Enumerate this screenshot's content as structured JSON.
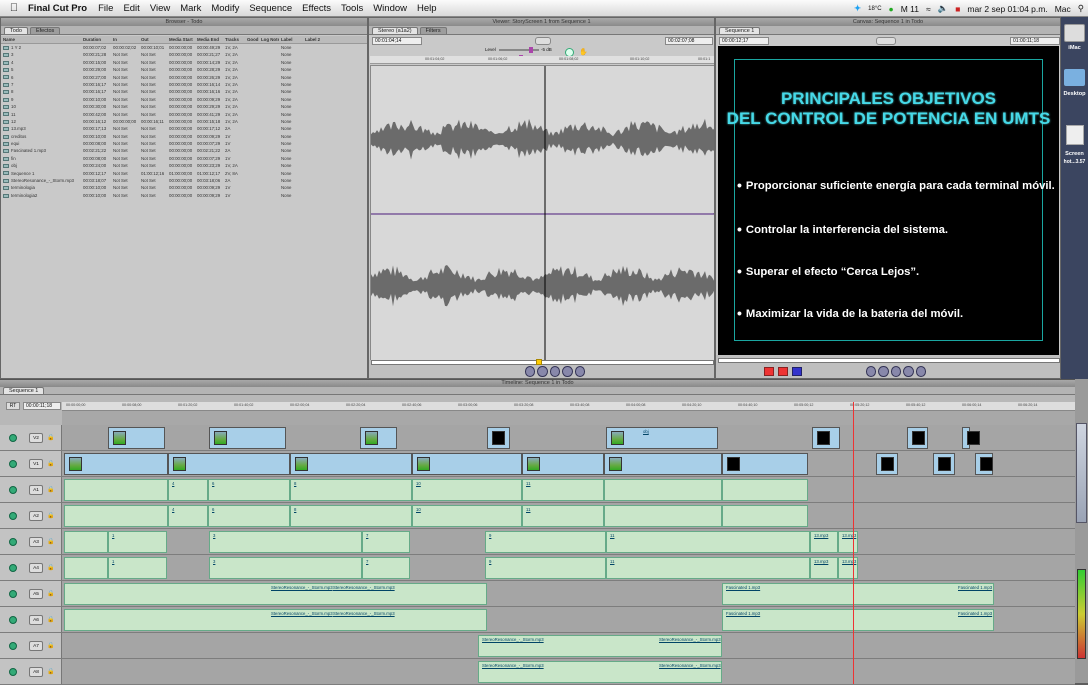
{
  "menubar": {
    "app": "Final Cut Pro",
    "items": [
      "File",
      "Edit",
      "View",
      "Mark",
      "Modify",
      "Sequence",
      "Effects",
      "Tools",
      "Window",
      "Help"
    ],
    "right": {
      "temp": "18°C",
      "battery": "M 11",
      "clock": "mar 2 sep 01:04 p.m.",
      "user": "Mac"
    }
  },
  "browser": {
    "title": "Browser - Todo",
    "tabs": [
      "Todo",
      "Efectos"
    ],
    "columns": [
      "Name",
      "Duration",
      "In",
      "Out",
      "Media Start",
      "Media End",
      "Tracks",
      "Good",
      "Log Note",
      "Label",
      "Label 2"
    ],
    "rows": [
      [
        "1 Y 2",
        "00:00:07;02",
        "00:00:02;02",
        "00:00:10;01",
        "00:00:00;00",
        "00:00:49;29",
        "1V, 2A",
        "",
        "",
        "None"
      ],
      [
        "3",
        "00:00:21;28",
        "Not Set",
        "Not Set",
        "00:00:00;00",
        "00:00:21;27",
        "1V, 2A",
        "",
        "",
        "None"
      ],
      [
        "4",
        "00:00:15;00",
        "Not Set",
        "Not Set",
        "00:00:00;00",
        "00:00:14;29",
        "1V, 2A",
        "",
        "",
        "None"
      ],
      [
        "5",
        "00:00:29;00",
        "Not Set",
        "Not Set",
        "00:00:00;00",
        "00:00:28;29",
        "1V, 2A",
        "",
        "",
        "None"
      ],
      [
        "6",
        "00:00:27;00",
        "Not Set",
        "Not Set",
        "00:00:00;00",
        "00:00:26;29",
        "1V, 2A",
        "",
        "",
        "None"
      ],
      [
        "7",
        "00:00:16;17",
        "Not Set",
        "Not Set",
        "00:00:00;00",
        "00:00:16;14",
        "1V, 2A",
        "",
        "",
        "None"
      ],
      [
        "8",
        "00:00:16;17",
        "Not Set",
        "Not Set",
        "00:00:00;00",
        "00:00:16;16",
        "1V, 2A",
        "",
        "",
        "None"
      ],
      [
        "9",
        "00:00:10;00",
        "Not Set",
        "Not Set",
        "00:00:00;00",
        "00:00:09;29",
        "1V, 2A",
        "",
        "",
        "None"
      ],
      [
        "10",
        "00:00:30;00",
        "Not Set",
        "Not Set",
        "00:00:00;00",
        "00:00:29;29",
        "1V, 2A",
        "",
        "",
        "None"
      ],
      [
        "11",
        "00:00:42;00",
        "Not Set",
        "Not Set",
        "00:00:00;00",
        "00:00:41;29",
        "1V, 2A",
        "",
        "",
        "None"
      ],
      [
        "12",
        "00:00:16;12",
        "00:00:00;00",
        "00:00:16;11",
        "00:00:00;00",
        "00:00:15;18",
        "1V, 2A",
        "",
        "",
        "None"
      ],
      [
        "13.mp3",
        "00:00:17;13",
        "Not Set",
        "Not Set",
        "00:00:00;00",
        "00:00:17;12",
        "2A",
        "",
        "",
        "None"
      ],
      [
        "creditos",
        "00:00:10;00",
        "Not Set",
        "Not Set",
        "00:00:00;00",
        "00:00:09;29",
        "1V",
        "",
        "",
        "None"
      ],
      [
        "equi",
        "00:00:08;00",
        "Not Set",
        "Not Set",
        "00:00:00;00",
        "00:00:07;29",
        "1V",
        "",
        "",
        "None"
      ],
      [
        "Fascinated 1.mp3",
        "00:02:21;22",
        "Not Set",
        "Not Set",
        "00:00:00;00",
        "00:02:21;22",
        "2A",
        "",
        "",
        "None"
      ],
      [
        "fin",
        "00:00:08;00",
        "Not Set",
        "Not Set",
        "00:00:00;00",
        "00:00:07;29",
        "1V",
        "",
        "",
        "None"
      ],
      [
        "obj",
        "00:00:24;00",
        "Not Set",
        "Not Set",
        "00:00:00;00",
        "00:00:23;29",
        "1V, 2A",
        "",
        "",
        "None"
      ],
      [
        "Sequence 1",
        "00:00:12;17",
        "Not Set",
        "01:00:12;16",
        "01:00:00;00",
        "01:00:12;17",
        "2V, 8A",
        "",
        "",
        "None"
      ],
      [
        "StereoResonance_-_Storm.mp3",
        "00:03:18;07",
        "Not Set",
        "Not Set",
        "00:00:00;00",
        "00:03:18;06",
        "2A",
        "",
        "",
        "None"
      ],
      [
        "terminologia",
        "00:00:10;00",
        "Not Set",
        "Not Set",
        "00:00:00;00",
        "00:00:09;29",
        "1V",
        "",
        "",
        "None"
      ],
      [
        "terminologia2",
        "00:00:10;00",
        "Not Set",
        "Not Set",
        "00:00:00;00",
        "00:00:09;29",
        "1V",
        "",
        "",
        "None"
      ]
    ]
  },
  "viewer": {
    "title": "Viewer: StoryScreen 1 from Sequence 1",
    "tabs": [
      "Stereo (a1a2)",
      "Filters"
    ],
    "timecode_left": "00:01:04;14",
    "timecode_right": "00:02:07;08",
    "level_label": "Level",
    "pan_label": "Pan",
    "level_value": "-5 dB",
    "pan_value": "-1",
    "ruler": [
      "00:01:04;02",
      "00:01:06;02",
      "00:01:08;02",
      "00:01:10;02",
      "00:01:1"
    ]
  },
  "canvas": {
    "title": "Canvas: Sequence 1 in Todo",
    "tab": "Sequence 1",
    "timecode_left": "00:00:12;17",
    "zoom": "100%",
    "timecode_right": "01:00:11;18",
    "slide_title": [
      "PRINCIPALES OBJETIVOS",
      "DEL CONTROL DE POTENCIA EN UMTS"
    ],
    "bullets": [
      "Proporcionar suficiente energía para cada terminal móvil.",
      "Controlar la interferencia del sistema.",
      "Superar el efecto “Cerca Lejos”.",
      "Maximizar la vida de la bateria del móvil."
    ]
  },
  "desktop": {
    "icons": [
      "iMac",
      "Desktop",
      "Screen"
    ],
    "screen_sub": "hot...3.57"
  },
  "timeline": {
    "title": "Timeline: Sequence 1 in Todo",
    "tab": "Sequence 1",
    "timecode": "00:00:11;18",
    "rt": "RT",
    "ruler": [
      "00:00:00;00",
      "00:00:08;00",
      "00:01:20;02",
      "00:01:40;02",
      "00:02:00;04",
      "00:02:20;04",
      "00:02:40;06",
      "00:03:00;06",
      "00:03:20;08",
      "00:03:40;08",
      "00:04:00;08",
      "00:04:20;10",
      "00:04:40;10",
      "00:05:00;12",
      "00:05:20;12",
      "00:05:40;12",
      "00:06:00;14",
      "00:06:20;14"
    ],
    "tracks": [
      "V2",
      "V1",
      "A1",
      "A2",
      "A3",
      "A4",
      "A5",
      "A6",
      "A7",
      "A8"
    ],
    "a1_clips": [
      "4",
      "6",
      "8",
      "10",
      "11"
    ],
    "a3_clips": [
      "1",
      "3",
      "7",
      "9",
      "11",
      "13.mp3",
      "13.mp3"
    ],
    "a5_clips": [
      "StereoResonance_-_Storm.mp3",
      "StereoResonance_-_Storm.mp3",
      "Fascinated 1.mp3",
      "Fascinated 1.mp3"
    ],
    "a7_clips": [
      "StereoResonance_-_Storm.mp3",
      "StereoResonance_-_Storm.mp3"
    ],
    "v2_label": "obj"
  }
}
